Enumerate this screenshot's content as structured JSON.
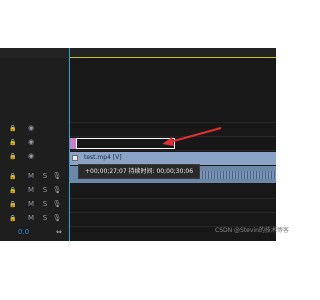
{
  "timeline": {
    "clip_name": "test.mp4 [V]",
    "tooltip_text": "+00;00;27;07  持续时间: 00;00;30;06",
    "time_readout": "0.0"
  },
  "track_headers": [
    {
      "c1": "⏸",
      "c2": "👁",
      "c3": ""
    },
    {
      "c1": "⏸",
      "c2": "👁",
      "c3": ""
    },
    {
      "c1": "⏸",
      "c2": "👁",
      "c3": ""
    },
    {
      "c1": "⏸",
      "c2": "M",
      "c3": "S"
    },
    {
      "c1": "⏸",
      "c2": "M",
      "c3": "S"
    },
    {
      "c1": "⏸",
      "c2": "M",
      "c3": "S"
    },
    {
      "c1": "⏸",
      "c2": "M",
      "c3": "S"
    }
  ],
  "watermark": "CSDN @Stevin的技术博客",
  "colors": {
    "clip_video": "#8aa3c6",
    "clip_audio": "#6d87a8",
    "playhead": "#2aa7d8",
    "annotation_arrow": "#e03030"
  },
  "icons": {
    "lock": "lock-icon",
    "eye": "eye-icon",
    "mic": "microphone-icon",
    "zoom": "zoom-to-fit-icon"
  }
}
